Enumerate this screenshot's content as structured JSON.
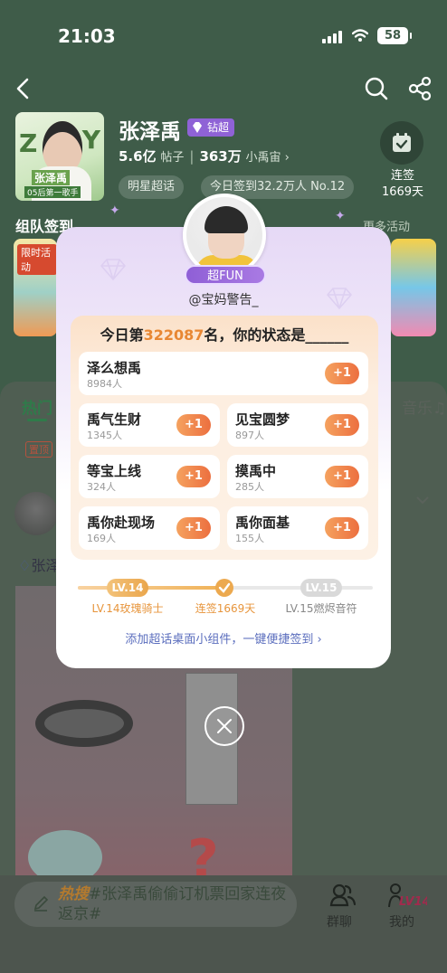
{
  "status_bar": {
    "time": "21:03",
    "battery": "58"
  },
  "topic": {
    "name": "张泽禹",
    "badge": "钻超",
    "posts_count": "5.6亿",
    "posts_label": "帖子",
    "fans_count": "363万",
    "fans_label": "小禹宙",
    "chips": [
      "明星超话",
      "今日签到32.2万人 No.12"
    ],
    "cover_text": [
      "Z",
      "Y"
    ],
    "cover_name": "张泽禹",
    "cover_line": "05后第一歌手"
  },
  "checkin": {
    "label": "连签",
    "days": "1669天"
  },
  "team": {
    "title": "组队签到",
    "more": "更多活动",
    "limited_badge": "限时活动"
  },
  "tabs": {
    "hot": "热门",
    "music": "音乐♫"
  },
  "feed": {
    "pinned": "置顶",
    "author_prefix": "张泽"
  },
  "bottom": {
    "hot_tag": "热搜",
    "hot_text": "#张泽禹偷偷订机票回家连夜返京#",
    "group_chat": "群聊",
    "me": "我的",
    "me_level": "LV14"
  },
  "modal": {
    "fun_badge": "超FUN",
    "username": "@宝妈警告_",
    "question_prefix": "今日第",
    "rank": "322087",
    "question_suffix": "名，你的状态是______",
    "options": [
      {
        "label": "泽么想禹",
        "count": "8984人",
        "action": "+1"
      },
      {
        "label": "禹气生财",
        "count": "1345人",
        "action": "+1"
      },
      {
        "label": "见宝圆梦",
        "count": "897人",
        "action": "+1"
      },
      {
        "label": "等宝上线",
        "count": "324人",
        "action": "+1"
      },
      {
        "label": "摸禹中",
        "count": "285人",
        "action": "+1"
      },
      {
        "label": "禹你赴现场",
        "count": "169人",
        "action": "+1"
      },
      {
        "label": "禹你面基",
        "count": "155人",
        "action": "+1"
      }
    ],
    "level": {
      "current": "LV.14",
      "next": "LV.15",
      "current_title": "LV.14玫瑰骑士",
      "streak": "连签1669天",
      "next_title": "LV.15燃烬音符",
      "progress": 0.5
    },
    "widget_link": "添加超话桌面小组件，一键便捷签到"
  },
  "colors": {
    "accent_orange": "#ec6f3f",
    "accent_purple": "#8f62d6",
    "link": "#5a6dbd"
  }
}
